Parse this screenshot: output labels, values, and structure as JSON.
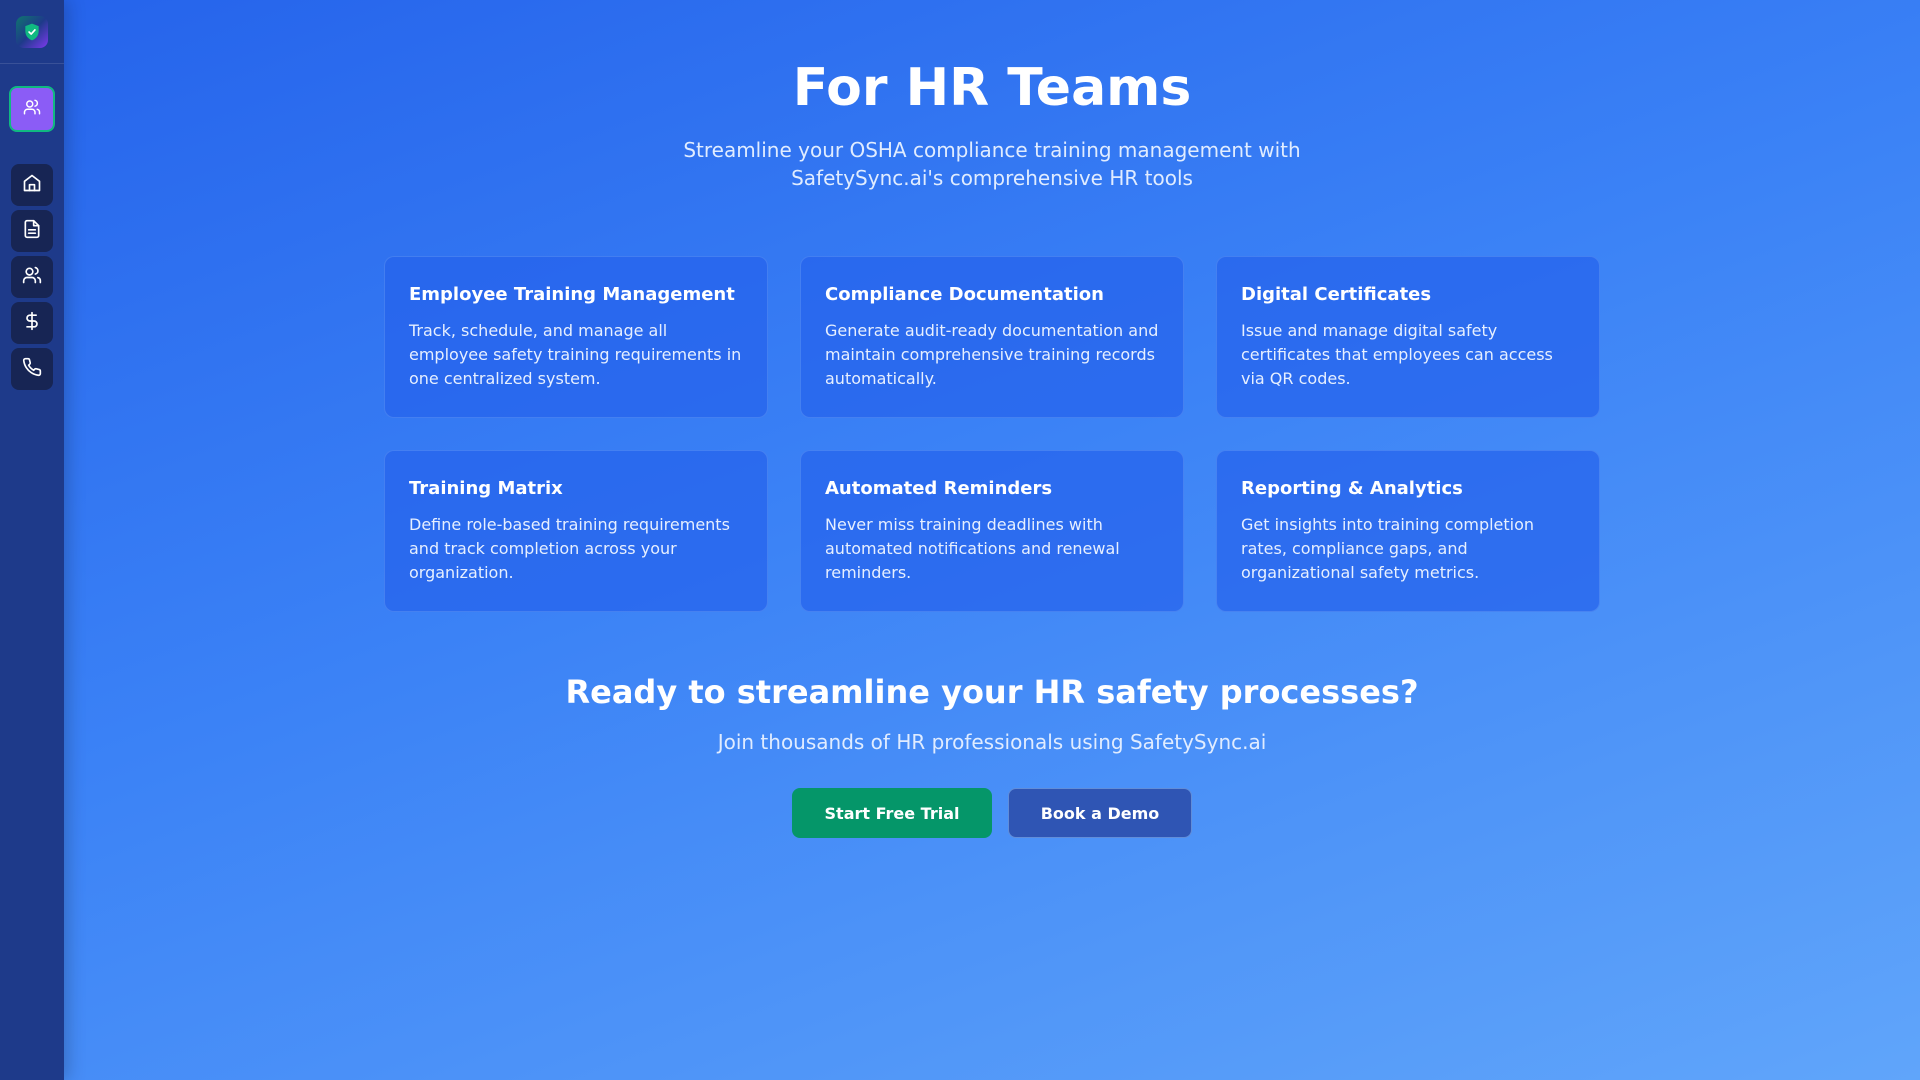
{
  "sidebar": {
    "logo_icon": "shield-check-icon",
    "active_section_icon": "users-icon",
    "nav": [
      {
        "icon": "home-icon",
        "name": "home"
      },
      {
        "icon": "document-icon",
        "name": "documents"
      },
      {
        "icon": "users-icon",
        "name": "users"
      },
      {
        "icon": "dollar-icon",
        "name": "pricing"
      },
      {
        "icon": "phone-icon",
        "name": "contact"
      }
    ]
  },
  "hero": {
    "title": "For HR Teams",
    "subtitle": "Streamline your OSHA compliance training management with SafetySync.ai's comprehensive HR tools"
  },
  "features": [
    {
      "title": "Employee Training Management",
      "description": "Track, schedule, and manage all employee safety training requirements in one centralized system."
    },
    {
      "title": "Compliance Documentation",
      "description": "Generate audit-ready documentation and maintain comprehensive training records automatically."
    },
    {
      "title": "Digital Certificates",
      "description": "Issue and manage digital safety certificates that employees can access via QR codes."
    },
    {
      "title": "Training Matrix",
      "description": "Define role-based training requirements and track completion across your organization."
    },
    {
      "title": "Automated Reminders",
      "description": "Never miss training deadlines with automated notifications and renewal reminders."
    },
    {
      "title": "Reporting & Analytics",
      "description": "Get insights into training completion rates, compliance gaps, and organizational safety metrics."
    }
  ],
  "cta": {
    "title": "Ready to streamline your HR safety processes?",
    "subtitle": "Join thousands of HR professionals using SafetySync.ai",
    "primary_label": "Start Free Trial",
    "secondary_label": "Book a Demo"
  },
  "colors": {
    "background_start": "#2563eb",
    "background_end": "#60a5fa",
    "sidebar": "#1e3a8a",
    "active_button": "#8b5cf6",
    "primary_button": "#059669",
    "secondary_button": "#2f55b4"
  }
}
